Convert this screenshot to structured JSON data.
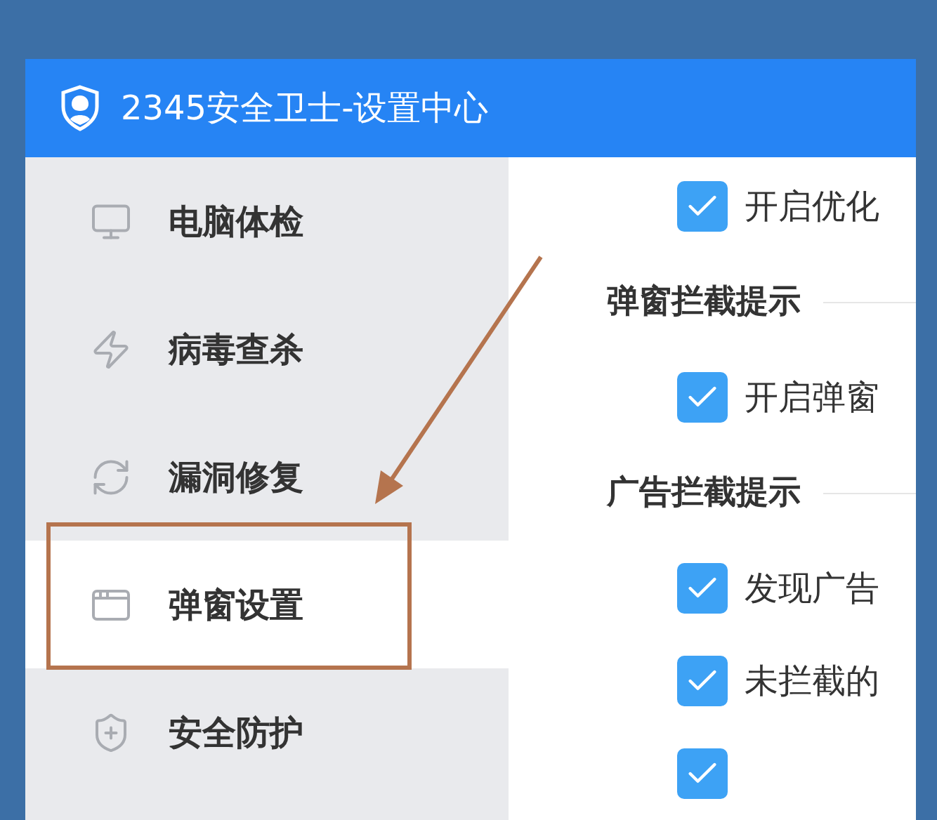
{
  "window": {
    "title": "2345安全卫士-设置中心"
  },
  "sidebar": {
    "items": [
      {
        "label": "电脑体检",
        "selected": false
      },
      {
        "label": "病毒查杀",
        "selected": false
      },
      {
        "label": "漏洞修复",
        "selected": false
      },
      {
        "label": "弹窗设置",
        "selected": true
      },
      {
        "label": "安全防护",
        "selected": false
      }
    ]
  },
  "content": [
    {
      "kind": "checkbox",
      "label": "开启优化",
      "checked": true
    },
    {
      "kind": "heading",
      "label": "弹窗拦截提示"
    },
    {
      "kind": "checkbox",
      "label": "开启弹窗",
      "checked": true
    },
    {
      "kind": "heading",
      "label": "广告拦截提示"
    },
    {
      "kind": "checkbox",
      "label": "发现广告",
      "checked": true
    },
    {
      "kind": "checkbox",
      "label": "未拦截的",
      "checked": true
    },
    {
      "kind": "checkbox",
      "checked": true
    }
  ],
  "annotation": {
    "highlight": true,
    "arrow": true
  }
}
